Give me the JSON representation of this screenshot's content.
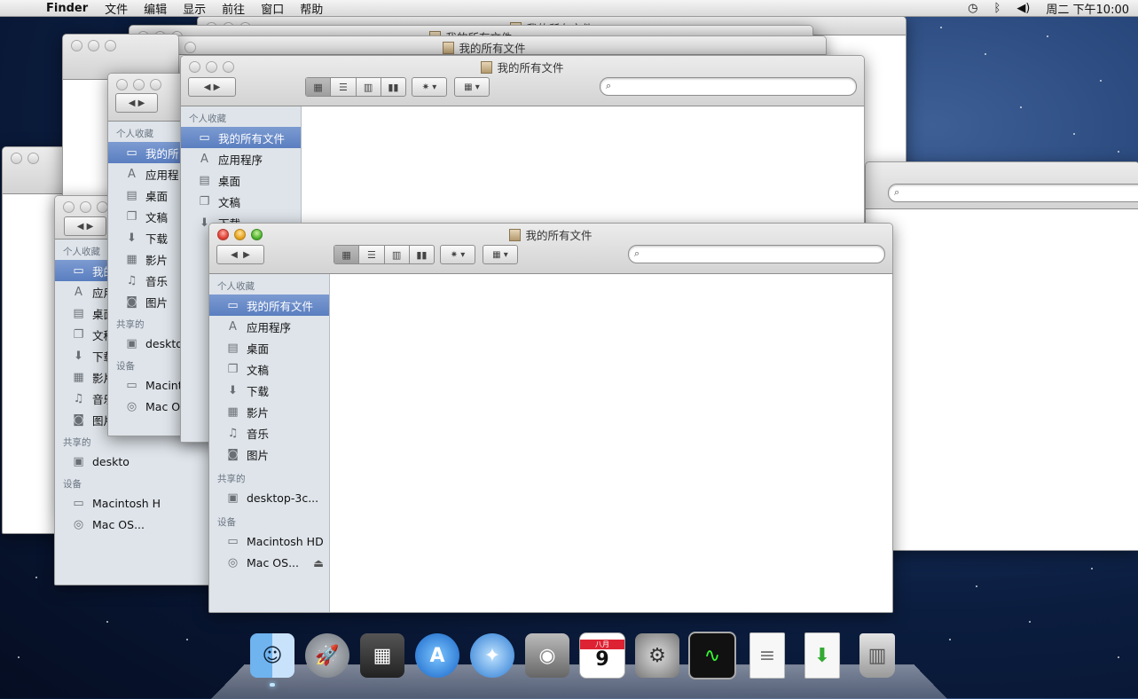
{
  "menubar": {
    "app_name": "Finder",
    "menus": [
      "文件",
      "编辑",
      "显示",
      "前往",
      "窗口",
      "帮助"
    ],
    "clock": "周二 下午10:00"
  },
  "window": {
    "title": "我的所有文件",
    "search_placeholder": "",
    "sidebar": {
      "favorites_header": "个人收藏",
      "favorites": [
        {
          "label": "我的所有文件",
          "icon": "all-files-icon",
          "selected": true
        },
        {
          "label": "应用程序",
          "icon": "applications-icon"
        },
        {
          "label": "桌面",
          "icon": "desktop-icon"
        },
        {
          "label": "文稿",
          "icon": "documents-icon"
        },
        {
          "label": "下载",
          "icon": "downloads-icon"
        },
        {
          "label": "影片",
          "icon": "movies-icon"
        },
        {
          "label": "音乐",
          "icon": "music-icon"
        },
        {
          "label": "图片",
          "icon": "pictures-icon"
        }
      ],
      "shared_header": "共享的",
      "shared": [
        {
          "label": "desktop-3c...",
          "icon": "computer-icon"
        }
      ],
      "devices_header": "设备",
      "devices": [
        {
          "label": "Macintosh HD",
          "icon": "hard-drive-icon"
        },
        {
          "label": "Mac OS...",
          "icon": "disc-icon",
          "eject": true
        }
      ]
    }
  },
  "back_window": {
    "sidebar": {
      "favorites": [
        "我的所有文件",
        "应用程序",
        "桌面",
        "文稿",
        "下载",
        "影片",
        "音乐",
        "图片"
      ],
      "shared": [
        "deskto"
      ],
      "devices": [
        "Macint",
        "Mac O"
      ]
    }
  },
  "left_window": {
    "sidebar": {
      "favorites": [
        "我的所",
        "应用程",
        "桌面",
        "文稿",
        "下载",
        "影片",
        "音乐",
        "图片"
      ],
      "shared": [
        "deskto"
      ],
      "devices": [
        "Macintosh H",
        "Mac OS..."
      ]
    }
  },
  "dock": {
    "items": [
      "finder-icon",
      "launchpad-icon",
      "photo-browser-icon",
      "app-store-icon",
      "safari-icon",
      "facetime-icon",
      "calendar-icon",
      "system-preferences-icon",
      "activity-monitor-icon",
      "document-icon",
      "installer-document-icon",
      "trash-icon"
    ],
    "calendar_month": "八月",
    "calendar_day": "9"
  },
  "colors": {
    "selection": "#5a7ec0",
    "sidebar": "#dee4ea"
  }
}
